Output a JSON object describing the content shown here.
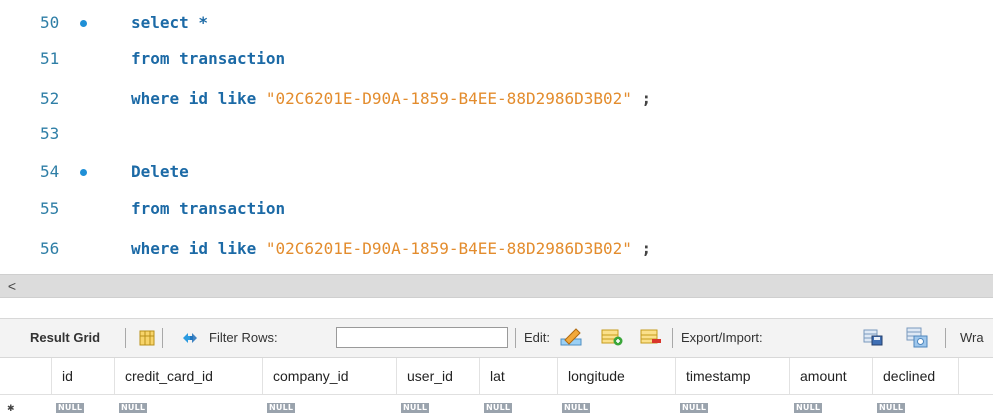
{
  "editor": {
    "lines": [
      {
        "num": "50",
        "dot": true,
        "tokens": [
          {
            "t": "select *",
            "c": "kw"
          }
        ]
      },
      {
        "num": "51",
        "dot": false,
        "tokens": [
          {
            "t": "from transaction",
            "c": "kw"
          }
        ]
      },
      {
        "num": "52",
        "dot": false,
        "tokens": [
          {
            "t": "where id like ",
            "c": "kw"
          },
          {
            "t": "\"02C6201E-D90A-1859-B4EE-88D2986D3B02\"",
            "c": "str"
          },
          {
            "t": " ;",
            "c": "punct"
          }
        ]
      },
      {
        "num": "53",
        "dot": false,
        "tokens": []
      },
      {
        "num": "54",
        "dot": true,
        "tokens": [
          {
            "t": "Delete",
            "c": "kw"
          }
        ]
      },
      {
        "num": "55",
        "dot": false,
        "tokens": [
          {
            "t": "from transaction",
            "c": "kw"
          }
        ]
      },
      {
        "num": "56",
        "dot": false,
        "tokens": [
          {
            "t": "where id like ",
            "c": "kw"
          },
          {
            "t": "\"02C6201E-D90A-1859-B4EE-88D2986D3B02\"",
            "c": "str"
          },
          {
            "t": " ;",
            "c": "punct"
          }
        ]
      }
    ]
  },
  "scrollbar": {
    "left_arrow": "<"
  },
  "toolbar": {
    "result_grid_label": "Result Grid",
    "filter_rows_label": "Filter Rows:",
    "filter_value": "",
    "edit_label": "Edit:",
    "export_label": "Export/Import:",
    "wrap_label": "Wra"
  },
  "grid": {
    "columns": [
      "id",
      "credit_card_id",
      "company_id",
      "user_id",
      "lat",
      "longitude",
      "timestamp",
      "amount",
      "declined"
    ],
    "null_label": "NULL",
    "row_marker": "✱"
  },
  "colors": {
    "keyword": "#1c6aa6",
    "string": "#e38c2d",
    "line_number": "#2e7ea6",
    "breakpoint_dot": "#1f8fd6"
  }
}
